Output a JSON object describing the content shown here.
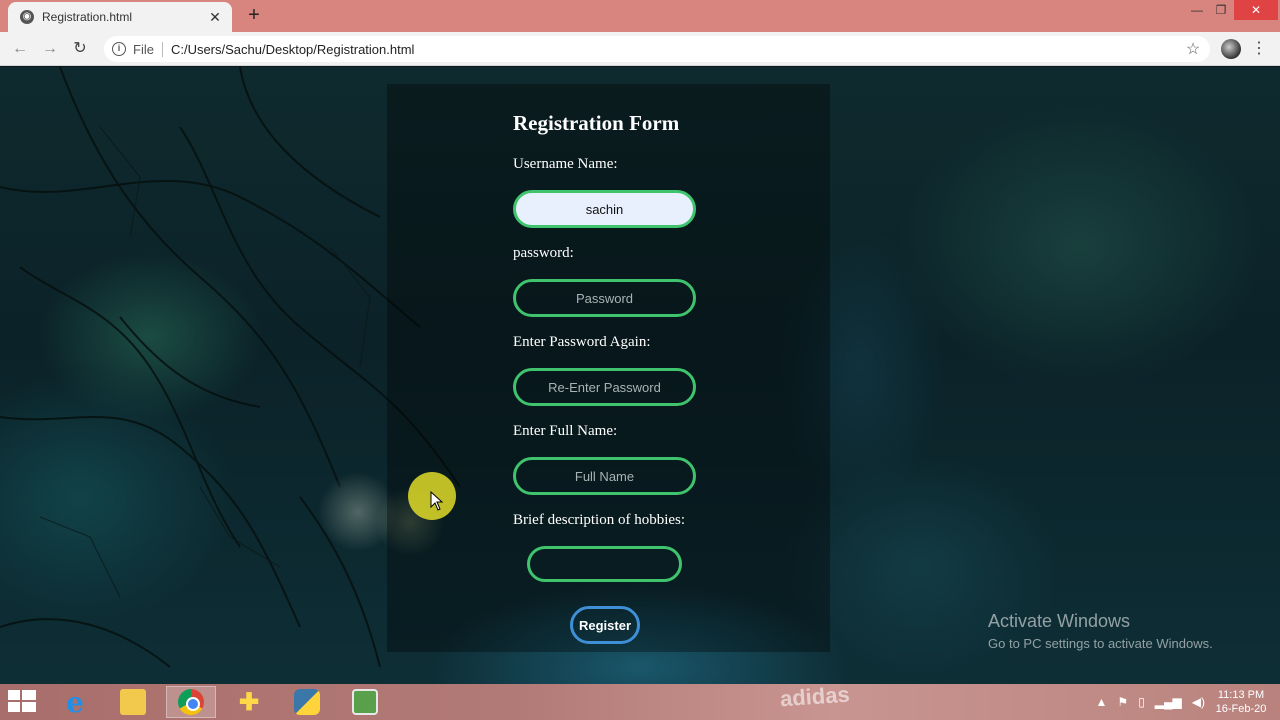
{
  "browser": {
    "tab_title": "Registration.html",
    "new_tab_label": "+",
    "window_controls": {
      "minimize": "—",
      "restore": "❐",
      "close": "✕"
    },
    "nav": {
      "back": "←",
      "forward": "→",
      "reload": "↻"
    },
    "address": {
      "scheme_label": "File",
      "url": "C:/Users/Sachu/Desktop/Registration.html"
    }
  },
  "form": {
    "title": "Registration Form",
    "username_label": "Username Name:",
    "username_value": "sachin",
    "password_label": "password:",
    "password_placeholder": "Password",
    "password_again_label": "Enter Password Again:",
    "password_again_placeholder": "Re-Enter Password",
    "fullname_label": "Enter Full Name:",
    "fullname_placeholder": "Full Name",
    "hobbies_label": "Brief description of hobbies:",
    "hobbies_value": "",
    "register_label": "Register"
  },
  "watermark": {
    "title": "Activate Windows",
    "subtitle": "Go to PC settings to activate Windows."
  },
  "taskbar": {
    "apps": [
      "start",
      "internet-explorer",
      "file-explorer",
      "chrome",
      "installer",
      "python",
      "notepad"
    ],
    "active_app": "chrome",
    "clock_time": "11:13 PM",
    "clock_date": "16-Feb-20",
    "background_text": "adidas"
  },
  "colors": {
    "field_border": "#3fc36c",
    "register_border": "#3f8fd6",
    "tabstrip": "#d9857f",
    "autofill_bg": "#e8f0fe"
  }
}
